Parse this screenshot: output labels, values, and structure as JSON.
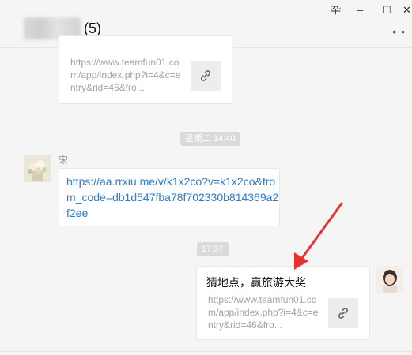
{
  "header": {
    "count": "(5)",
    "controls": {
      "pin": "卆",
      "minimize": "–",
      "maximize": "☐",
      "close": "✕"
    },
    "more": "• •"
  },
  "messages": {
    "top_card": {
      "url": "https://www.teamfun01.com/app/index.php?i=4&c=entry&rid=46&fro..."
    },
    "time1": "星期二 14:40",
    "sender_name": "宋",
    "link_text": "https://aa.rrxiu.me/v/k1x2co?v=k1x2co&from_code=db1d547fba78f702330b814369a2f2ee",
    "time2": "17:37",
    "my_card": {
      "title": "猜地点，赢旅游大奖",
      "url": "https://www.teamfun01.com/app/index.php?i=4&c=entry&rid=46&fro..."
    }
  },
  "colors": {
    "link": "#2a7bd1",
    "arrow": "#e63232",
    "time_chip": "#dadada"
  },
  "icons": [
    "link-icon",
    "annotation-arrow"
  ]
}
